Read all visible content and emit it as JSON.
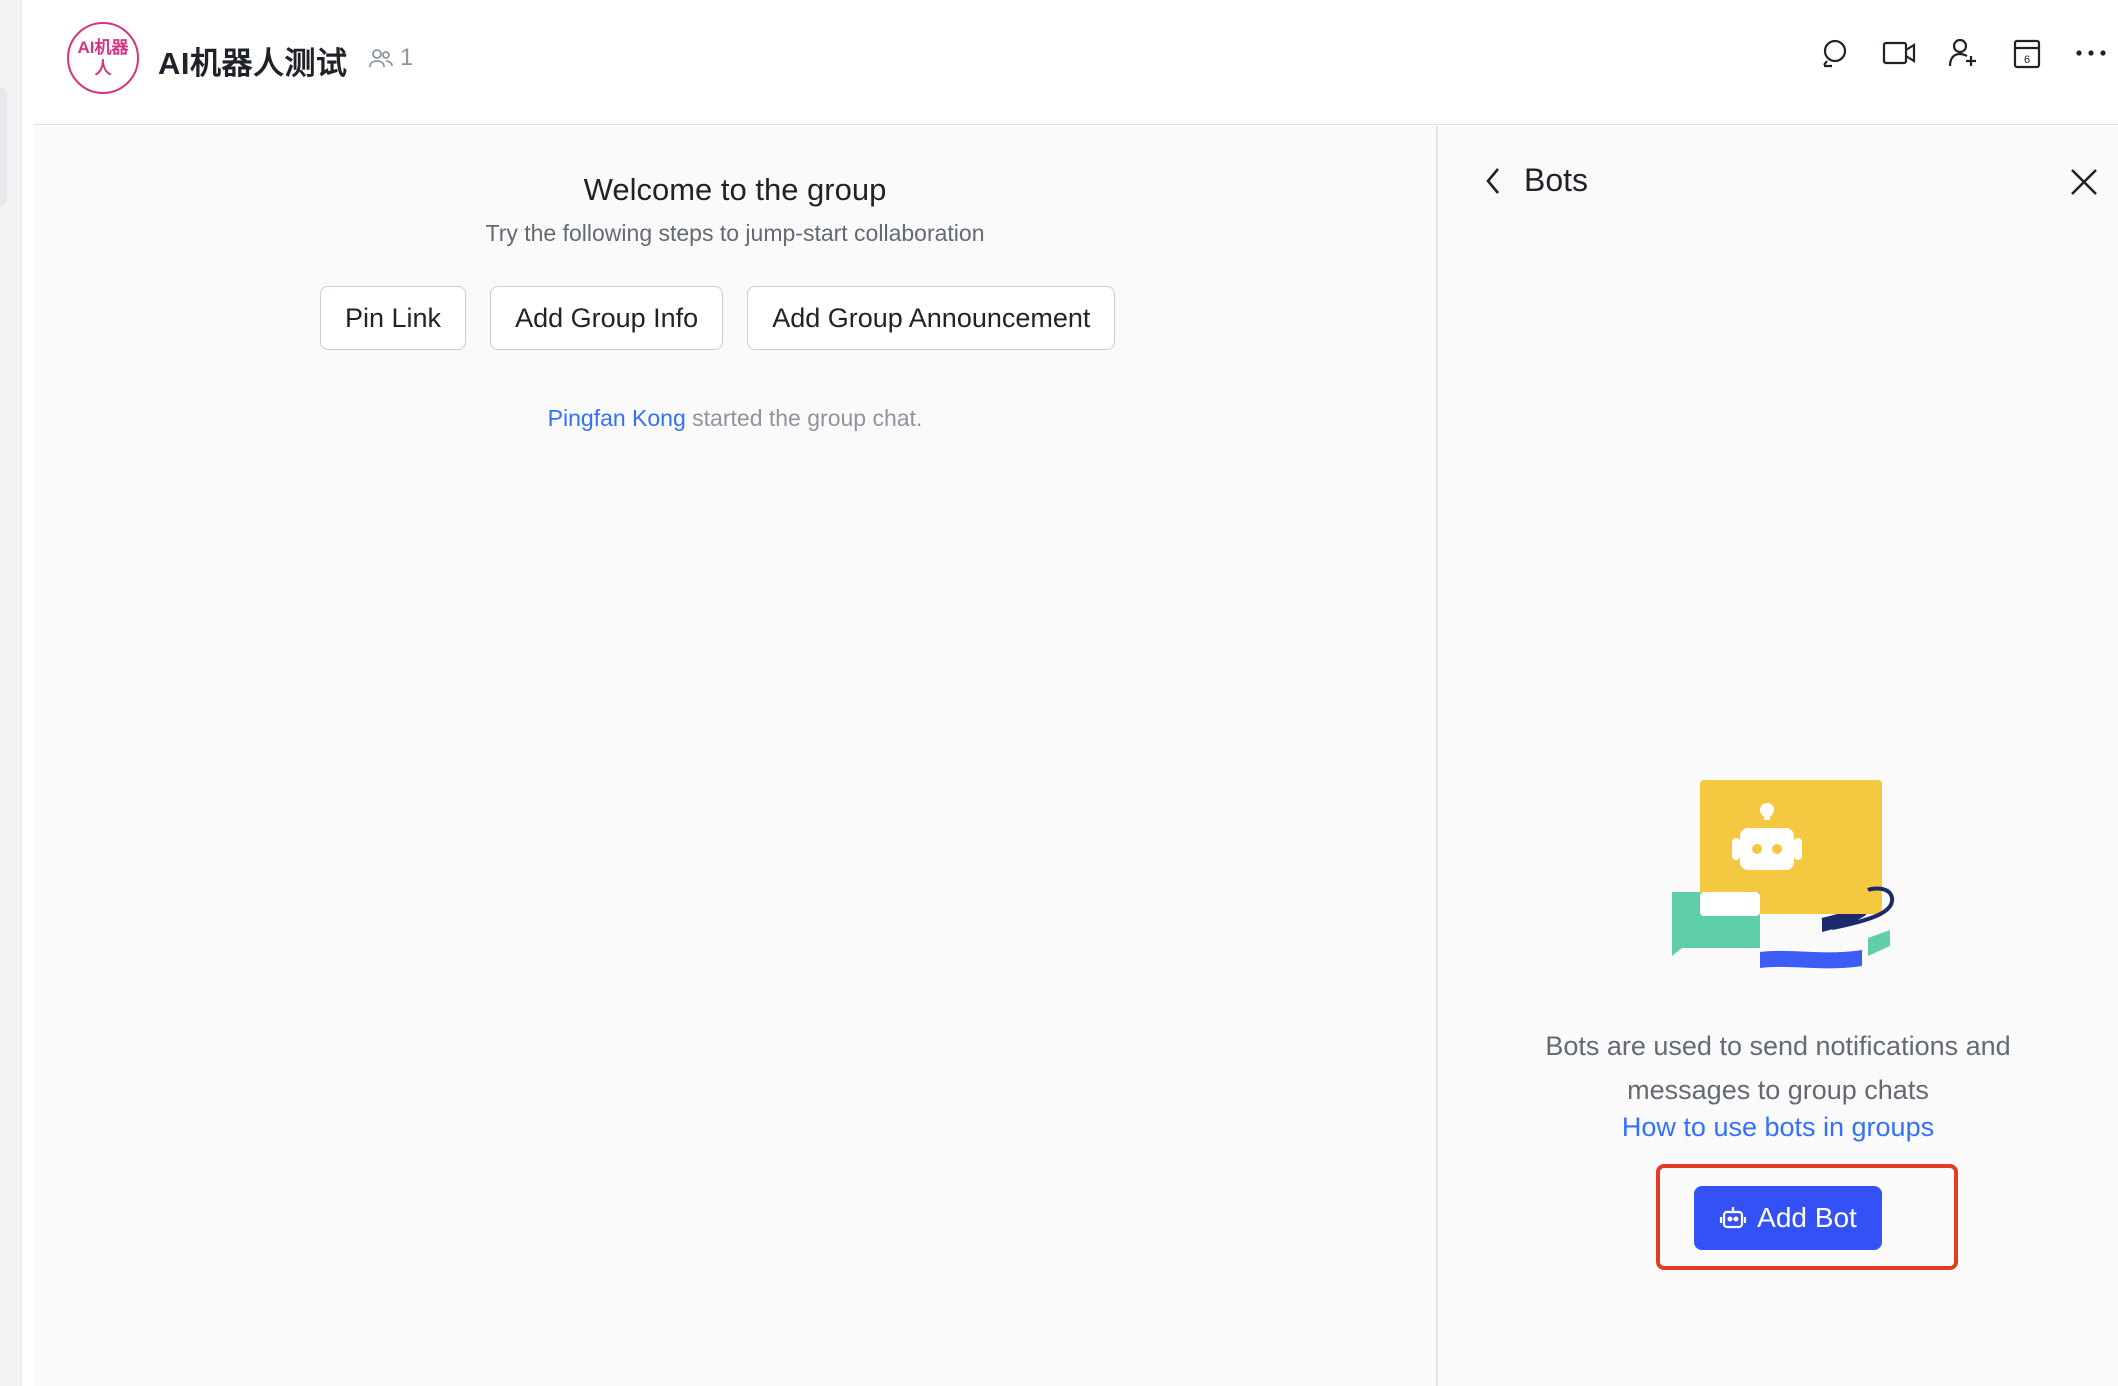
{
  "header": {
    "avatar_text": "AI机器人",
    "title": "AI机器人测试",
    "member_count": "1",
    "tools": [
      "search-icon",
      "video-call-icon",
      "add-member-icon",
      "calendar-icon",
      "more-icon"
    ],
    "calendar_day": "6"
  },
  "chat": {
    "welcome_title": "Welcome to the group",
    "welcome_subtitle": "Try the following steps to jump-start collaboration",
    "actions": {
      "pin_link": "Pin Link",
      "add_group_info": "Add Group Info",
      "add_group_announcement": "Add Group Announcement"
    },
    "system_message": {
      "user": "Pingfan Kong",
      "text": "started the group chat."
    }
  },
  "bots_panel": {
    "title": "Bots",
    "description_line1": "Bots are used to send notifications and",
    "description_line2": "messages to group chats",
    "help_link": "How to use bots in groups",
    "add_bot_label": "Add Bot"
  },
  "colors": {
    "accent": "#3351f5",
    "link": "#3370ff",
    "avatar": "#d63384",
    "highlight": "#e03e1e",
    "bot_yellow": "#f5c842",
    "bubble_green": "#5ecfa9",
    "ribbon_blue": "#3d5cf5"
  }
}
